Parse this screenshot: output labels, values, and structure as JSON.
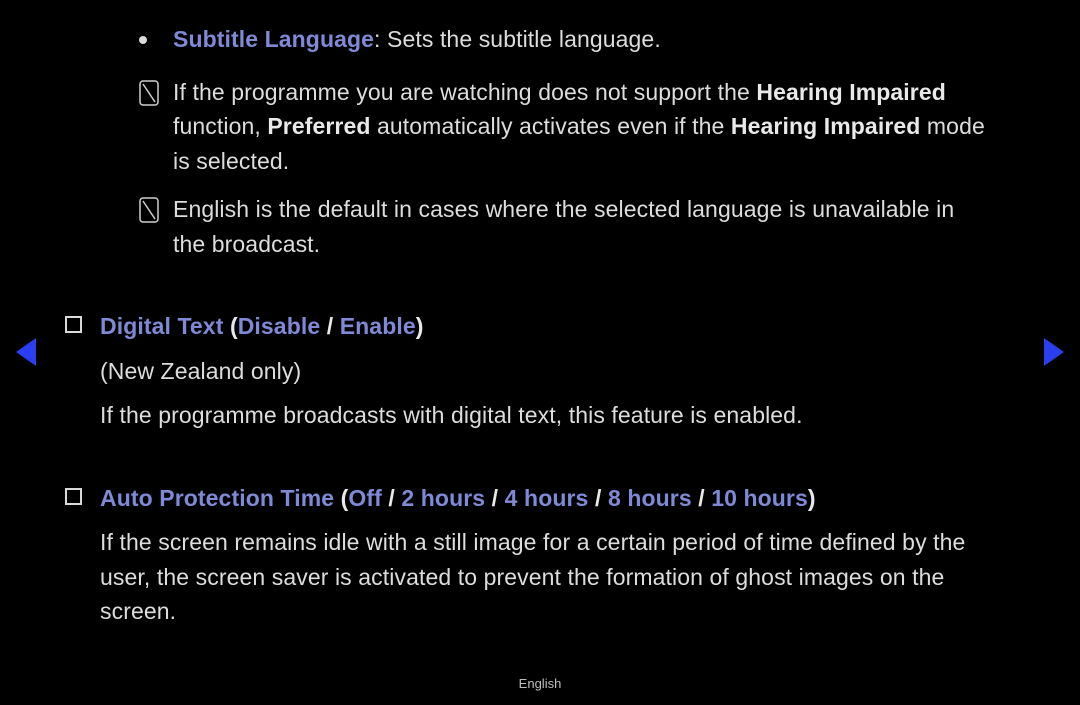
{
  "colors": {
    "accent": "#8089d6"
  },
  "subtitle_language": {
    "label": "Subtitle Language",
    "desc": ": Sets the subtitle language."
  },
  "note1": {
    "p1a": "If the programme you are watching does not support the ",
    "t1": "Hearing Impaired",
    "p1b": " function, ",
    "t2": "Preferred",
    "p1c": " automatically activates even if the ",
    "t3": "Hearing Impaired",
    "p1d": " mode is selected."
  },
  "note2": {
    "text": "English is the default in cases where the selected language is unavailable in the broadcast."
  },
  "digital_text": {
    "label": "Digital Text",
    "open": " (",
    "opt1": "Disable",
    "sep": " / ",
    "opt2": "Enable",
    "close": ")",
    "note": "(New Zealand only)",
    "desc": "If the programme broadcasts with digital text, this feature is enabled."
  },
  "auto_protection": {
    "label": "Auto Protection Time",
    "open": " (",
    "o1": "Off",
    "o2": "2 hours",
    "o3": "4 hours",
    "o4": "8 hours",
    "o5": "10 hours",
    "sep": " / ",
    "close": ")",
    "desc": "If the screen remains idle with a still image for a certain period of time defined by the user, the screen saver is activated to prevent the formation of ghost images on the screen."
  },
  "footer": "English"
}
